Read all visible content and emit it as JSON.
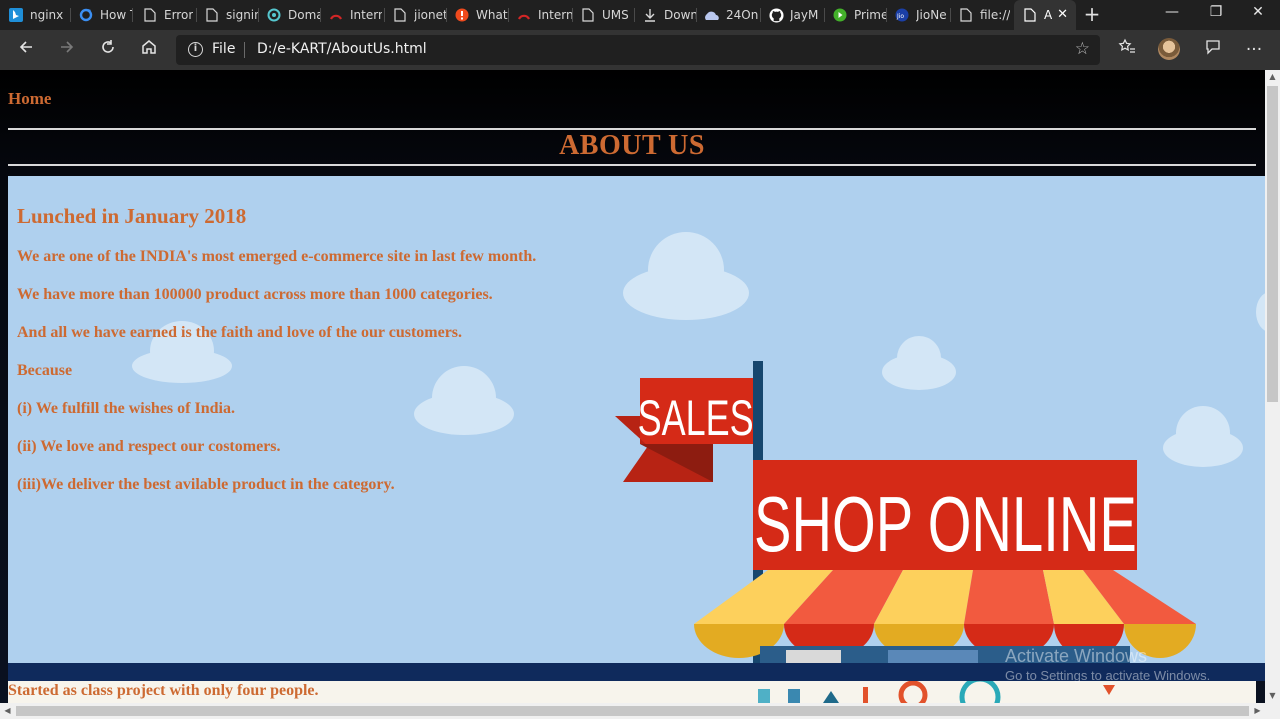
{
  "browser": {
    "tabs": [
      {
        "title": "nginx",
        "icon": "bing-icon"
      },
      {
        "title": "How T",
        "icon": "refresh-blue-icon"
      },
      {
        "title": "Error",
        "icon": "page-icon"
      },
      {
        "title": "signin",
        "icon": "page-icon"
      },
      {
        "title": "Doma",
        "icon": "domain-icon"
      },
      {
        "title": "Intern",
        "icon": "gauge-red-icon"
      },
      {
        "title": "jionet",
        "icon": "page-icon"
      },
      {
        "title": "What",
        "icon": "alert-orange-icon"
      },
      {
        "title": "Intern",
        "icon": "gauge-red-icon"
      },
      {
        "title": "UMS",
        "icon": "page-icon"
      },
      {
        "title": "Down",
        "icon": "download-icon"
      },
      {
        "title": "24On",
        "icon": "cloud-icon"
      },
      {
        "title": "JayM",
        "icon": "github-icon"
      },
      {
        "title": "Prime",
        "icon": "play-green-icon"
      },
      {
        "title": "JioNe",
        "icon": "jio-icon"
      },
      {
        "title": "file://",
        "icon": "page-icon"
      },
      {
        "title": "A",
        "icon": "page-icon",
        "active": true
      }
    ],
    "address": {
      "scheme_label": "File",
      "url": "D:/e-KART/AboutUs.html"
    },
    "window_controls": {
      "minimize": "—",
      "restore": "❐",
      "close": "✕"
    }
  },
  "page": {
    "nav": {
      "home_label": "Home"
    },
    "title": "ABOUT US",
    "hero": {
      "heading": "Lunched in January 2018",
      "lines": [
        "We are one of the INDIA's most emerged e-commerce site in last few month.",
        "We have more than 100000 product across more than 1000 categories.",
        "And all we have earned is the faith and love of the our customers.",
        "Because",
        "(i) We fulfill the wishes of India.",
        "(ii) We love and respect our costomers.",
        "(iii)We deliver the best avilable product in the category."
      ],
      "graphic": {
        "flag_text": "SALES",
        "sign_text": "SHOP ONLINE"
      }
    },
    "footer_text": "Started as class project with only four people."
  },
  "os_watermark": {
    "line1": "Activate Windows",
    "line2": "Go to Settings to activate Windows."
  },
  "colors": {
    "accent_text": "#cd6a32",
    "hero_bg": "#afd0ee",
    "sign_red": "#d52a17",
    "awning_yellow": "#fdd05c",
    "awning_red": "#f25a3f"
  }
}
